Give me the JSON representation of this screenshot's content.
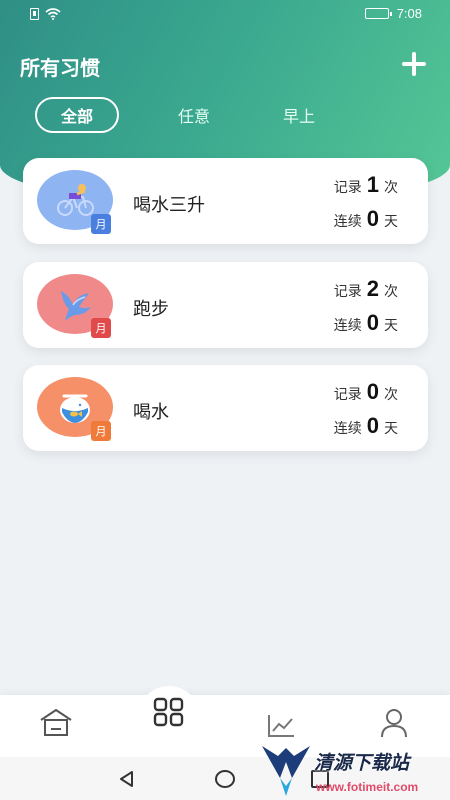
{
  "status_bar": {
    "time": "7:08"
  },
  "header": {
    "title": "所有习惯"
  },
  "tabs": [
    {
      "label": "全部"
    },
    {
      "label": "任意"
    },
    {
      "label": "早上"
    }
  ],
  "habits": [
    {
      "name": "喝水三升",
      "badge": "月",
      "record_label": "记录",
      "record_count": "1",
      "record_unit": "次",
      "streak_label": "连续",
      "streak_count": "0",
      "streak_unit": "天",
      "icon": "cyclist-icon",
      "icon_bg": "#8fb4f2",
      "badge_color": "#4a7fe0"
    },
    {
      "name": "跑步",
      "badge": "月",
      "record_label": "记录",
      "record_count": "2",
      "record_unit": "次",
      "streak_label": "连续",
      "streak_count": "0",
      "streak_unit": "天",
      "icon": "dove-icon",
      "icon_bg": "#f08a8a",
      "badge_color": "#e04a4a"
    },
    {
      "name": "喝水",
      "badge": "月",
      "record_label": "记录",
      "record_count": "0",
      "record_unit": "次",
      "streak_label": "连续",
      "streak_count": "0",
      "streak_unit": "天",
      "icon": "fishbowl-icon",
      "icon_bg": "#f59068",
      "badge_color": "#f07a3a"
    }
  ],
  "bottom_nav": [
    {
      "icon": "home-icon"
    },
    {
      "icon": "grid-icon"
    },
    {
      "icon": "chart-icon"
    },
    {
      "icon": "profile-icon"
    }
  ],
  "watermark": {
    "text1": "清源下载站",
    "text2": "www.fotimeit.com"
  },
  "colors": {
    "header_start": "#2f8f86",
    "header_end": "#55c796",
    "page_bg": "#eef2f5"
  }
}
